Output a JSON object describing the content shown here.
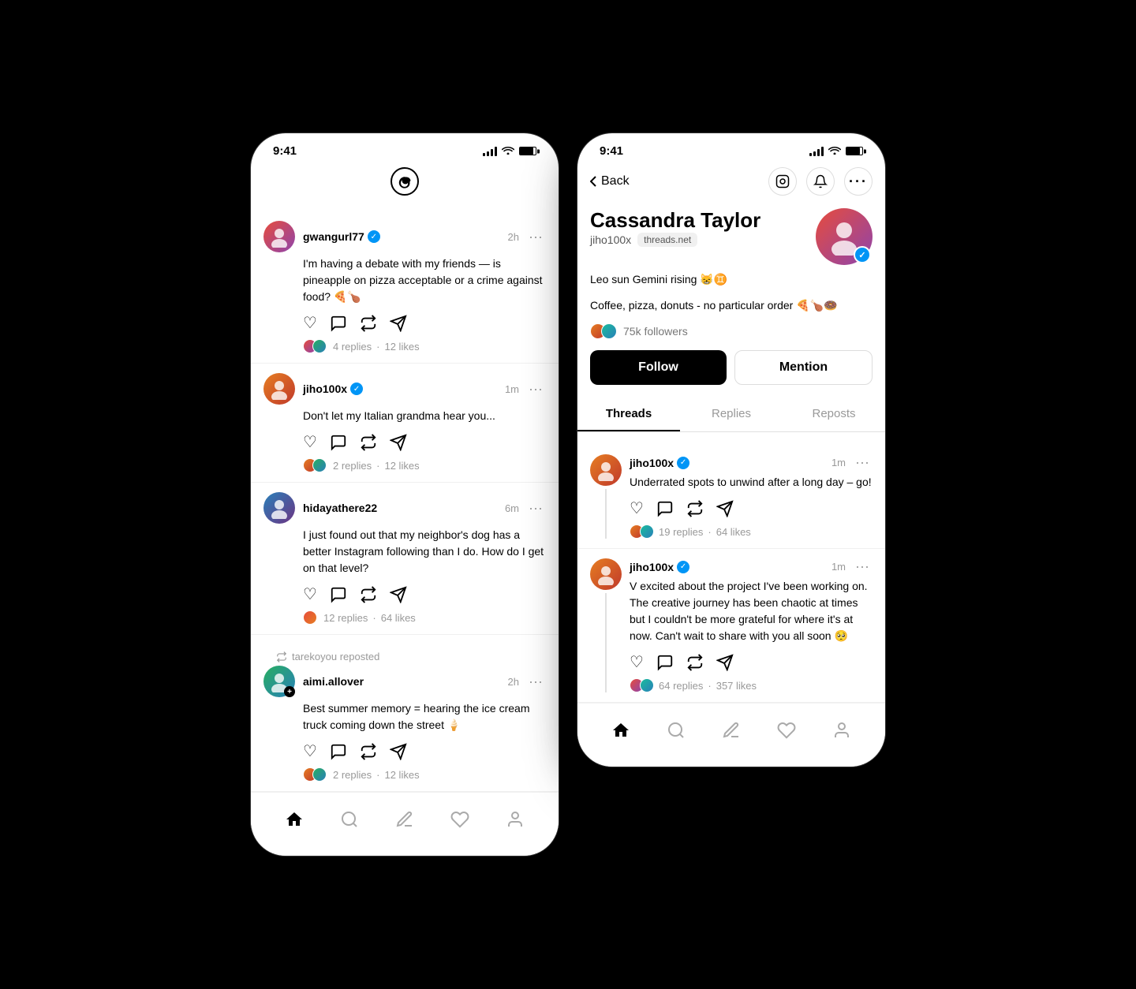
{
  "phone1": {
    "statusBar": {
      "time": "9:41"
    },
    "header": {
      "logo": "Ⓣ"
    },
    "posts": [
      {
        "id": "post1",
        "username": "gwangurl77",
        "verified": true,
        "time": "2h",
        "avatarEmoji": "👤",
        "text": "I'm having a debate with my friends — is pineapple on pizza acceptable or a crime against food? 🍕🍗",
        "replies": "4 replies",
        "likes": "12 likes",
        "hasStatsAvatars": true
      },
      {
        "id": "post2",
        "username": "jiho100x",
        "verified": true,
        "time": "1m",
        "avatarEmoji": "👤",
        "text": "Don't let my Italian grandma hear you...",
        "replies": "2 replies",
        "likes": "12 likes",
        "hasStatsAvatars": true
      },
      {
        "id": "post3",
        "username": "hidayathere22",
        "verified": false,
        "time": "6m",
        "avatarEmoji": "👤",
        "text": "I just found out that my neighbor's dog has a better Instagram following than I do. How do I get on that level?",
        "replies": "12 replies",
        "likes": "64 likes",
        "hasStatsAvatars": true
      },
      {
        "id": "post4",
        "repostedBy": "tarekoyou reposted",
        "username": "aimi.allover",
        "verified": false,
        "time": "2h",
        "avatarEmoji": "👤",
        "text": "Best summer memory = hearing the ice cream truck coming down the street 🍦",
        "replies": "2 replies",
        "likes": "12 likes",
        "hasStatsAvatars": true
      }
    ],
    "bottomNav": {
      "home": "🏠",
      "search": "🔍",
      "post": "✏️",
      "likes": "♡",
      "profile": "👤"
    }
  },
  "phone2": {
    "statusBar": {
      "time": "9:41"
    },
    "header": {
      "backLabel": "Back",
      "instagramIcon": "◻",
      "notifIcon": "🔔",
      "moreIcon": "⋯"
    },
    "profile": {
      "name": "Cassandra Taylor",
      "handle": "jiho100x",
      "badge": "threads.net",
      "verified": true,
      "bio1": "Leo sun Gemini rising 😸♊",
      "bio2": "Coffee, pizza, donuts - no particular order 🍕🍗🍩",
      "followers": "75k followers",
      "followLabel": "Follow",
      "mentionLabel": "Mention",
      "tabs": [
        "Threads",
        "Replies",
        "Reposts"
      ]
    },
    "profilePosts": [
      {
        "id": "pp1",
        "username": "jiho100x",
        "verified": true,
        "time": "1m",
        "text": "Underrated spots to unwind after a long day – go!",
        "replies": "19 replies",
        "likes": "64 likes"
      },
      {
        "id": "pp2",
        "username": "jiho100x",
        "verified": true,
        "time": "1m",
        "text": "V excited about the project I've been working on. The creative journey has been chaotic at times but I couldn't be more grateful for where it's at now. Can't wait to share with you all soon 🥺",
        "replies": "64 replies",
        "likes": "357 likes"
      }
    ],
    "bottomNav": {
      "home": "🏠",
      "search": "🔍",
      "post": "✏️",
      "likes": "♡",
      "profile": "👤"
    }
  }
}
